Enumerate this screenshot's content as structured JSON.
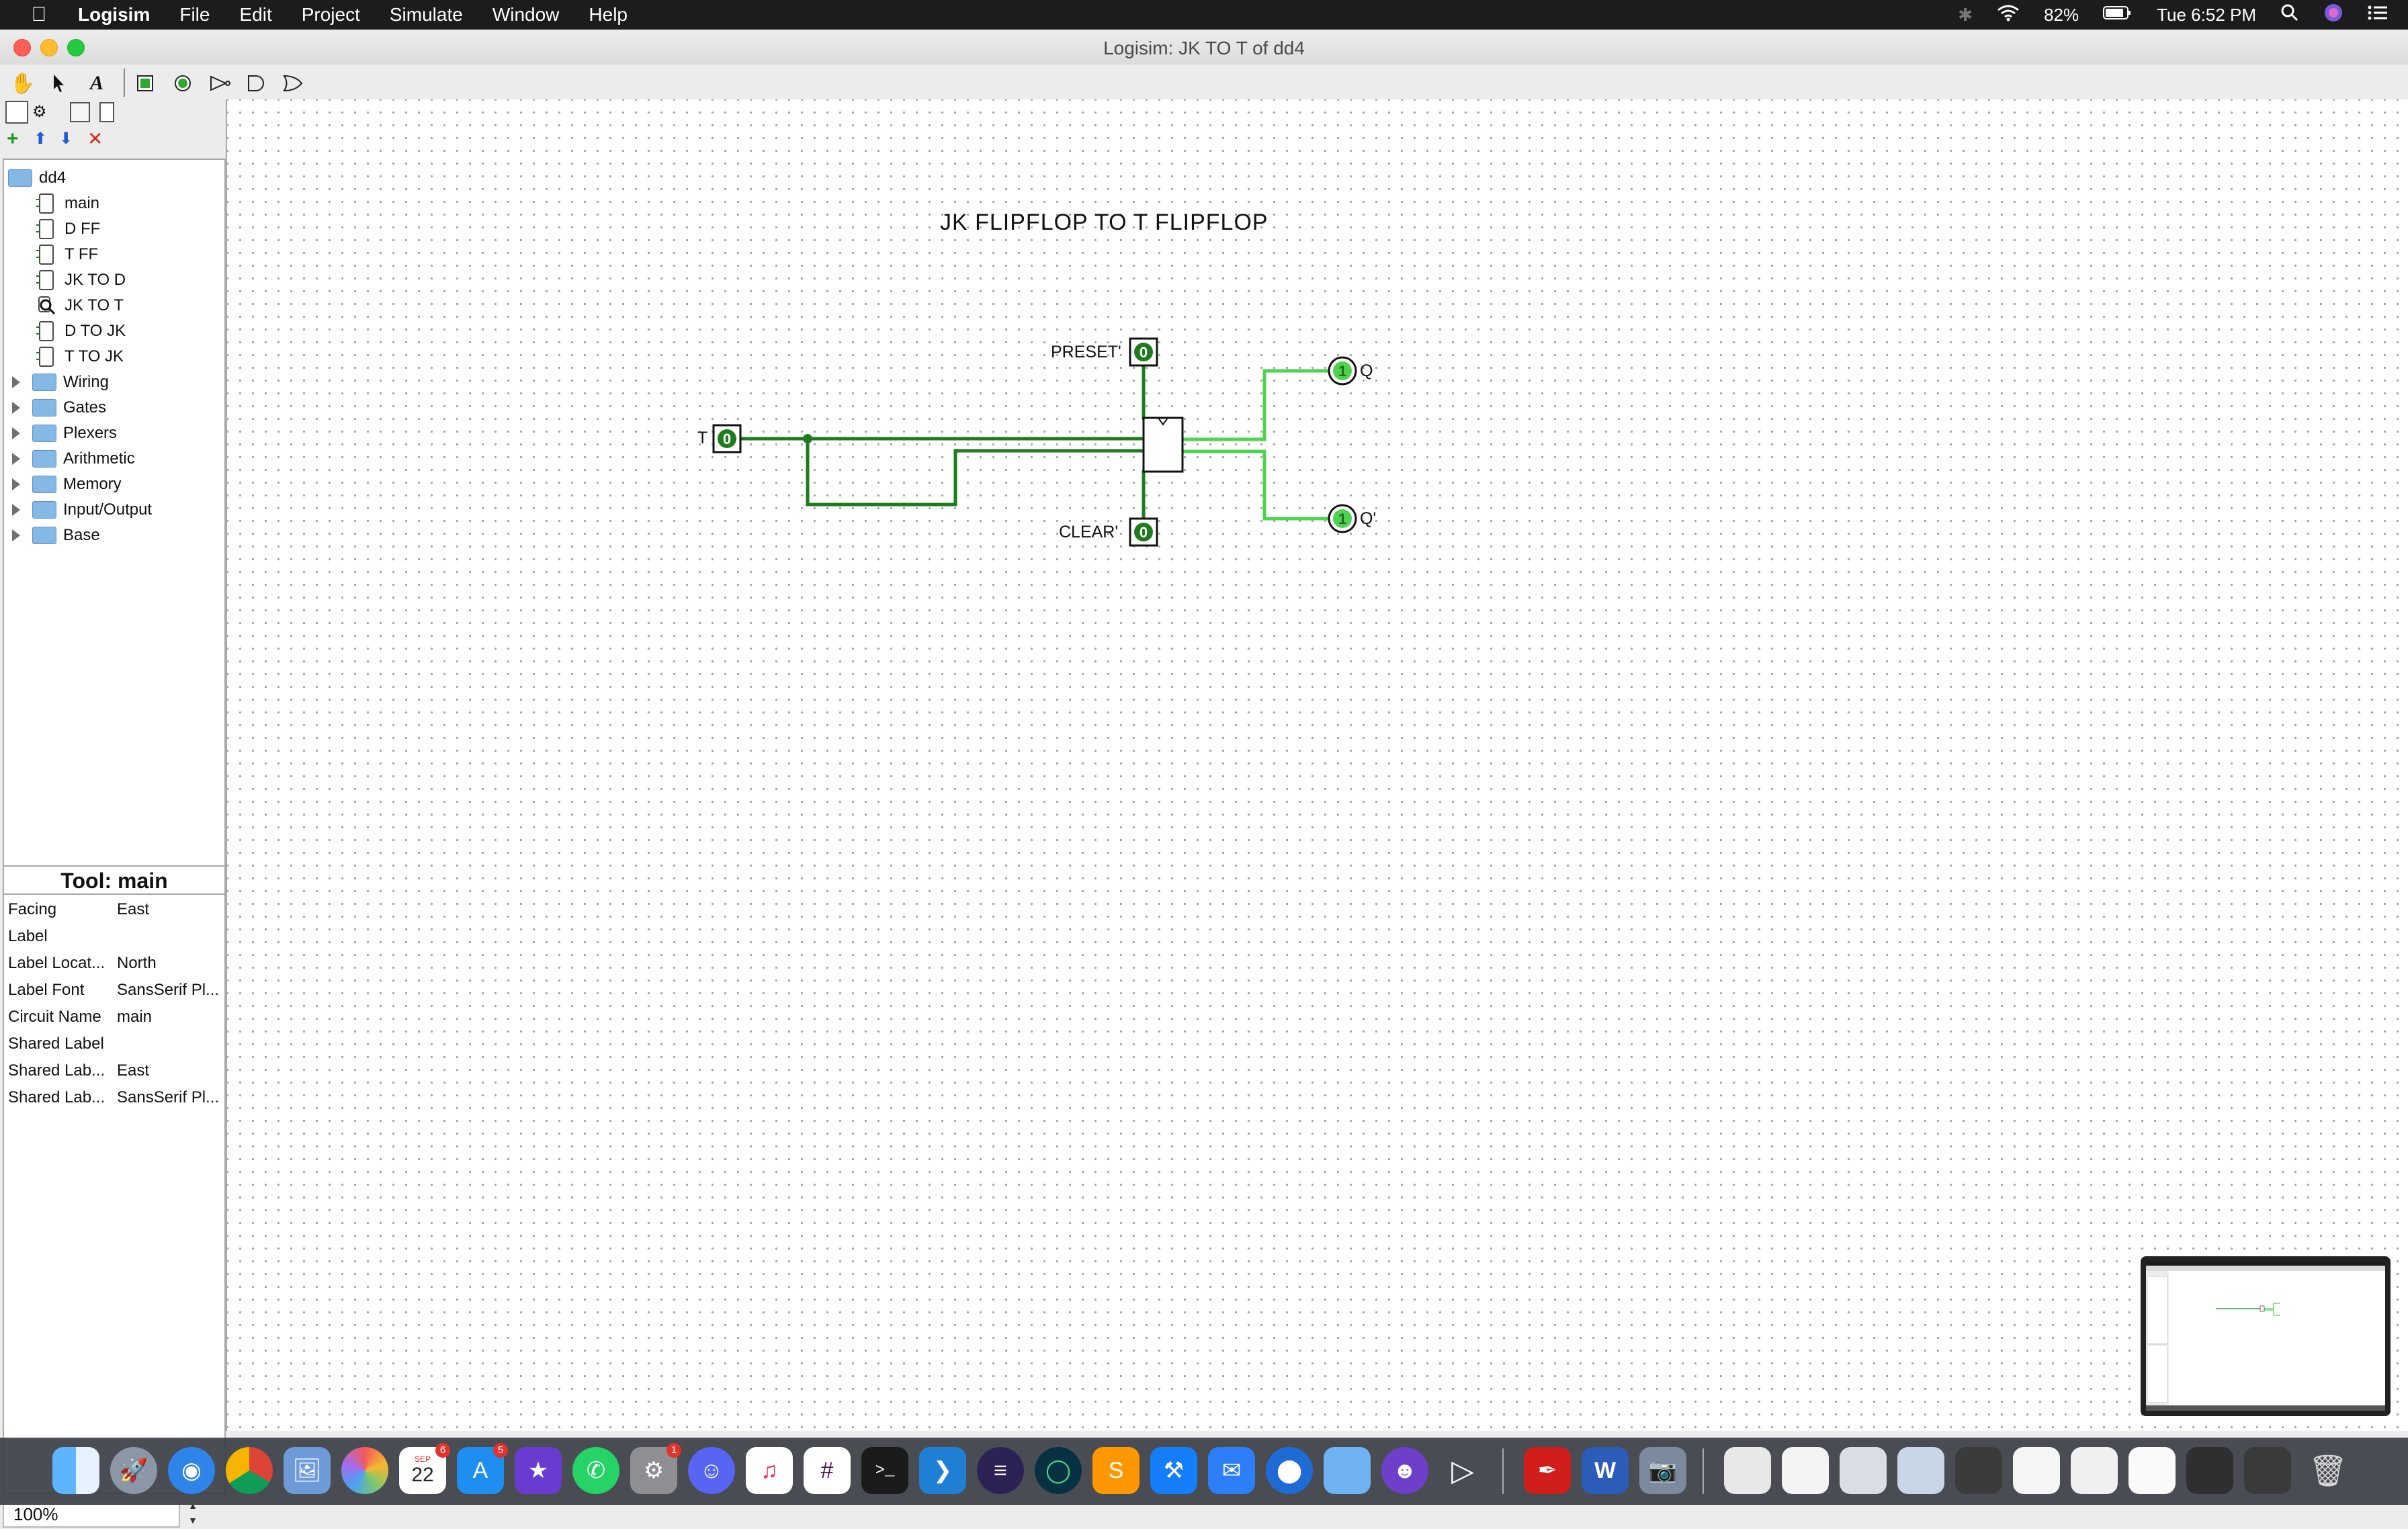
{
  "menubar": {
    "app_name": "Logisim",
    "items": [
      "File",
      "Edit",
      "Project",
      "Simulate",
      "Window",
      "Help"
    ],
    "status": {
      "battery": "82%",
      "clock": "Tue 6:52 PM"
    }
  },
  "window": {
    "title": "Logisim: JK TO T of dd4"
  },
  "toolbar": {
    "tools": [
      "poke-tool",
      "select-tool",
      "text-tool",
      "input-pin-tool",
      "output-pin-tool",
      "not-gate-tool",
      "and-gate-tool",
      "or-gate-tool"
    ]
  },
  "explorer": {
    "project": "dd4",
    "circuits": [
      "main",
      "D FF",
      "T FF",
      "JK TO D",
      "JK TO T",
      "D TO JK",
      "T TO JK"
    ],
    "active_circuit": "JK TO T",
    "libraries": [
      "Wiring",
      "Gates",
      "Plexers",
      "Arithmetic",
      "Memory",
      "Input/Output",
      "Base"
    ]
  },
  "attributes": {
    "header": "Tool: main",
    "rows": [
      {
        "key": "Facing",
        "value": "East"
      },
      {
        "key": "Label",
        "value": ""
      },
      {
        "key": "Label Locat...",
        "value": "North"
      },
      {
        "key": "Label Font",
        "value": "SansSerif Pl..."
      },
      {
        "key": "Circuit Name",
        "value": "main"
      },
      {
        "key": "Shared Label",
        "value": ""
      },
      {
        "key": "Shared Lab...",
        "value": "East"
      },
      {
        "key": "Shared Lab...",
        "value": "SansSerif Pl..."
      }
    ]
  },
  "zoom": {
    "value": "100%"
  },
  "canvas": {
    "title": "JK FLIPFLOP TO T FLIPFLOP",
    "pins": {
      "t": {
        "label": "T",
        "value": "0"
      },
      "preset": {
        "label": "PRESET'",
        "value": "0"
      },
      "clear": {
        "label": "CLEAR'",
        "value": "0"
      },
      "q": {
        "label": "Q",
        "value": "1"
      },
      "qbar": {
        "label": "Q'",
        "value": "1"
      }
    },
    "colors": {
      "wire_low": "#1e7b1e",
      "wire_high": "#4fd34f"
    }
  },
  "dock": {
    "apps": [
      "finder-icon",
      "launchpad-icon",
      "safari-icon",
      "chrome-icon",
      "preview-icon",
      "photos-icon",
      "calendar-icon",
      "app-store-icon",
      "imovie-icon",
      "whatsapp-icon",
      "system-preferences-icon",
      "discord-icon",
      "music-icon",
      "slack-icon",
      "terminal-icon",
      "vscode-icon",
      "eclipse-icon",
      "android-studio-icon",
      "sublime-text-icon",
      "xcode-icon",
      "xcode-tools-icon",
      "sourcetree-icon",
      "folder-icon",
      "github-desktop-icon",
      "logisim-icon",
      "acrobat-icon",
      "word-icon",
      "image-capture-icon",
      "documents-icon",
      "recent-doc-1-icon",
      "recent-doc-2-icon",
      "recent-doc-3-icon",
      "recent-doc-4-icon",
      "recent-doc-5-icon",
      "recent-doc-6-icon",
      "recent-doc-7-icon",
      "recent-doc-8-icon",
      "recent-doc-9-icon",
      "recent-doc-10-icon",
      "trash-icon"
    ],
    "calendar_day": "22",
    "calendar_month": "SEP",
    "badges": {
      "calendar": "6",
      "app_store": "5",
      "system_preferences": "1"
    }
  }
}
